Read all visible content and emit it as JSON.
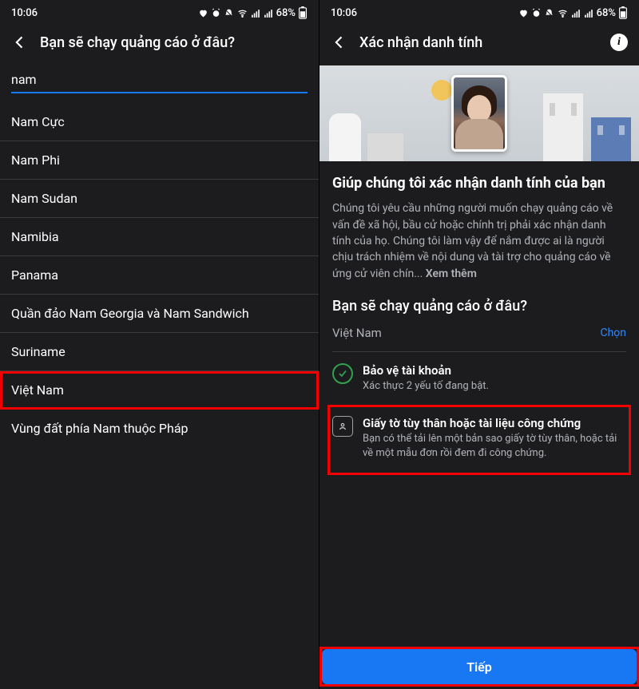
{
  "status": {
    "time": "10:06",
    "battery": "68%"
  },
  "left": {
    "title": "Bạn sẽ chạy quảng cáo ở đâu?",
    "search_value": "nam",
    "items": [
      "Nam Cực",
      "Nam Phi",
      "Nam Sudan",
      "Namibia",
      "Panama",
      "Quần đảo Nam Georgia và Nam Sandwich",
      "Suriname",
      "Việt Nam",
      "Vùng đất phía Nam thuộc Pháp"
    ],
    "highlight_index": 7
  },
  "right": {
    "title": "Xác nhận danh tính",
    "headline": "Giúp chúng tôi xác nhận danh tính của bạn",
    "description": "Chúng tôi yêu cầu những người muốn chạy quảng cáo về vấn đề xã hội, bầu cử hoặc chính trị phải xác nhận danh tính của họ. Chúng tôi làm vậy để nắm được ai là người chịu trách nhiệm về nội dung và tài trợ cho quảng cáo về ứng cử viên chín... ",
    "more": "Xem thêm",
    "question": "Bạn sẽ chạy quảng cáo ở đâu?",
    "country": "Việt Nam",
    "choose": "Chọn",
    "step1_title": "Bảo vệ tài khoản",
    "step1_sub": "Xác thực 2 yếu tố đang bật.",
    "step2_title": "Giấy tờ tùy thân hoặc tài liệu công chứng",
    "step2_sub": "Bạn có thể tải lên một bản sao giấy tờ tùy thân, hoặc tải về một mẫu đơn rồi đem đi công chứng.",
    "next": "Tiếp"
  }
}
